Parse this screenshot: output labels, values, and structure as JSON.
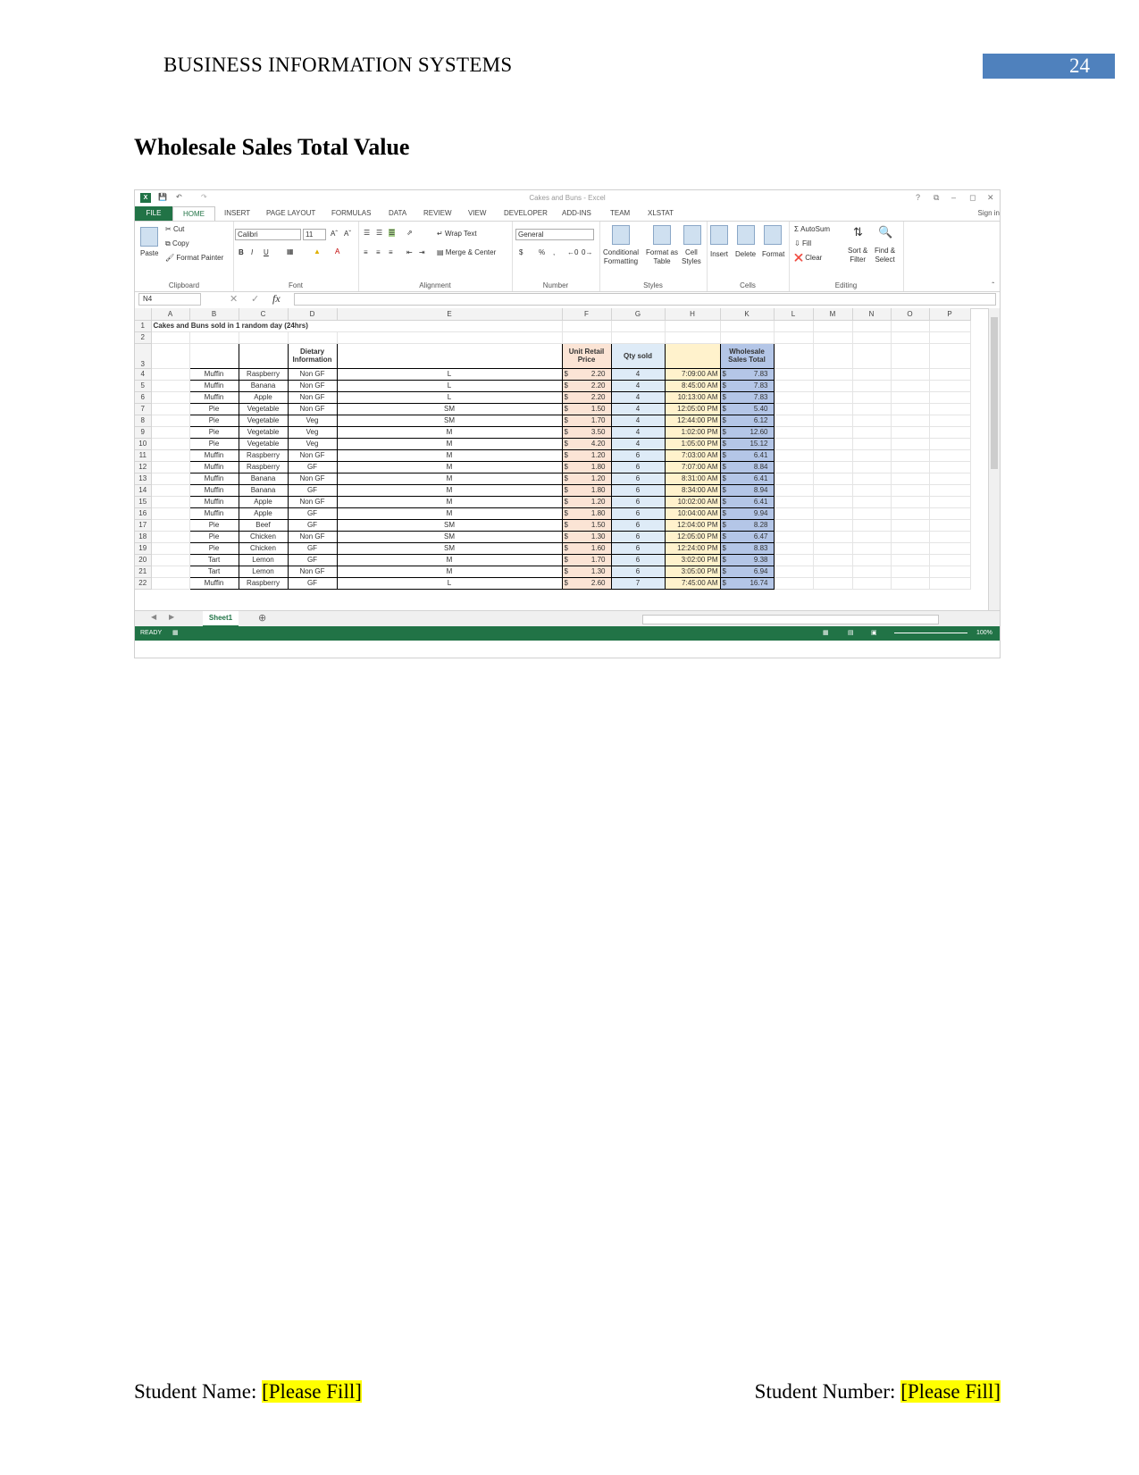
{
  "header": {
    "title": "BUSINESS INFORMATION SYSTEMS",
    "page_number": "24"
  },
  "section_heading": "Wholesale Sales Total Value",
  "excel": {
    "window_title": "Cakes and Buns - Excel",
    "window_controls": [
      "?",
      "⧉",
      "–",
      "◻",
      "✕"
    ],
    "tabs": [
      "FILE",
      "HOME",
      "INSERT",
      "PAGE LAYOUT",
      "FORMULAS",
      "DATA",
      "REVIEW",
      "VIEW",
      "DEVELOPER",
      "ADD-INS",
      "TEAM",
      "XLSTAT"
    ],
    "sign_in": "Sign in",
    "ribbon": {
      "clipboard": {
        "paste": "Paste",
        "cut": "Cut",
        "copy": "Copy",
        "format_painter": "Format Painter",
        "label": "Clipboard"
      },
      "font": {
        "font_name": "Calibri",
        "font_size": "11",
        "bold": "B",
        "italic": "I",
        "underline": "U",
        "label": "Font"
      },
      "alignment": {
        "wrap_text": "Wrap Text",
        "merge_center": "Merge & Center",
        "label": "Alignment"
      },
      "number": {
        "format": "General",
        "currency": "$",
        "percent": "%",
        "comma": ",",
        "label": "Number"
      },
      "styles": {
        "conditional_formatting": [
          "Conditional",
          "Formatting"
        ],
        "format_as_table": [
          "Format as",
          "Table"
        ],
        "cell_styles": [
          "Cell",
          "Styles"
        ],
        "label": "Styles"
      },
      "cells": {
        "insert": "Insert",
        "delete": "Delete",
        "format": "Format",
        "label": "Cells"
      },
      "editing": {
        "autosum": "AutoSum",
        "fill": "Fill",
        "clear": "Clear",
        "sort_filter": [
          "Sort &",
          "Filter"
        ],
        "find_select": [
          "Find &",
          "Select"
        ],
        "label": "Editing"
      }
    },
    "name_box": "N4",
    "fx_symbol": "fx",
    "column_headers": [
      "",
      "A",
      "B",
      "C",
      "D",
      "E",
      "F",
      "G",
      "H",
      "K",
      "L",
      "M",
      "N",
      "O",
      "P"
    ],
    "row1_title": "Cakes and Buns sold in 1 random day (24hrs)",
    "table_header": {
      "dietary": [
        "Dietary",
        "Information"
      ],
      "unit_price": [
        "Unit Retail",
        "Price"
      ],
      "qty": "Qty sold",
      "wholesale": [
        "Wholesale",
        "Sales Total"
      ]
    },
    "currency_symbol": "$",
    "rows": [
      {
        "n": "4",
        "b": "Muffin",
        "c": "Raspberry",
        "d": "Non GF",
        "e": "L",
        "price": "2.20",
        "qty": "4",
        "time": "7:09:00 AM",
        "total": "7.83"
      },
      {
        "n": "5",
        "b": "Muffin",
        "c": "Banana",
        "d": "Non GF",
        "e": "L",
        "price": "2.20",
        "qty": "4",
        "time": "8:45:00 AM",
        "total": "7.83"
      },
      {
        "n": "6",
        "b": "Muffin",
        "c": "Apple",
        "d": "Non GF",
        "e": "L",
        "price": "2.20",
        "qty": "4",
        "time": "10:13:00 AM",
        "total": "7.83"
      },
      {
        "n": "7",
        "b": "Pie",
        "c": "Vegetable",
        "d": "Non GF",
        "e": "SM",
        "price": "1.50",
        "qty": "4",
        "time": "12:05:00 PM",
        "total": "5.40"
      },
      {
        "n": "8",
        "b": "Pie",
        "c": "Vegetable",
        "d": "Veg",
        "e": "SM",
        "price": "1.70",
        "qty": "4",
        "time": "12:44:00 PM",
        "total": "6.12"
      },
      {
        "n": "9",
        "b": "Pie",
        "c": "Vegetable",
        "d": "Veg",
        "e": "M",
        "price": "3.50",
        "qty": "4",
        "time": "1:02:00 PM",
        "total": "12.60"
      },
      {
        "n": "10",
        "b": "Pie",
        "c": "Vegetable",
        "d": "Veg",
        "e": "M",
        "price": "4.20",
        "qty": "4",
        "time": "1:05:00 PM",
        "total": "15.12"
      },
      {
        "n": "11",
        "b": "Muffin",
        "c": "Raspberry",
        "d": "Non GF",
        "e": "M",
        "price": "1.20",
        "qty": "6",
        "time": "7:03:00 AM",
        "total": "6.41"
      },
      {
        "n": "12",
        "b": "Muffin",
        "c": "Raspberry",
        "d": "GF",
        "e": "M",
        "price": "1.80",
        "qty": "6",
        "time": "7:07:00 AM",
        "total": "8.84"
      },
      {
        "n": "13",
        "b": "Muffin",
        "c": "Banana",
        "d": "Non GF",
        "e": "M",
        "price": "1.20",
        "qty": "6",
        "time": "8:31:00 AM",
        "total": "6.41"
      },
      {
        "n": "14",
        "b": "Muffin",
        "c": "Banana",
        "d": "GF",
        "e": "M",
        "price": "1.80",
        "qty": "6",
        "time": "8:34:00 AM",
        "total": "8.94"
      },
      {
        "n": "15",
        "b": "Muffin",
        "c": "Apple",
        "d": "Non GF",
        "e": "M",
        "price": "1.20",
        "qty": "6",
        "time": "10:02:00 AM",
        "total": "6.41"
      },
      {
        "n": "16",
        "b": "Muffin",
        "c": "Apple",
        "d": "GF",
        "e": "M",
        "price": "1.80",
        "qty": "6",
        "time": "10:04:00 AM",
        "total": "9.94"
      },
      {
        "n": "17",
        "b": "Pie",
        "c": "Beef",
        "d": "GF",
        "e": "SM",
        "price": "1.50",
        "qty": "6",
        "time": "12:04:00 PM",
        "total": "8.28"
      },
      {
        "n": "18",
        "b": "Pie",
        "c": "Chicken",
        "d": "Non GF",
        "e": "SM",
        "price": "1.30",
        "qty": "6",
        "time": "12:05:00 PM",
        "total": "6.47"
      },
      {
        "n": "19",
        "b": "Pie",
        "c": "Chicken",
        "d": "GF",
        "e": "SM",
        "price": "1.60",
        "qty": "6",
        "time": "12:24:00 PM",
        "total": "8.83"
      },
      {
        "n": "20",
        "b": "Tart",
        "c": "Lemon",
        "d": "GF",
        "e": "M",
        "price": "1.70",
        "qty": "6",
        "time": "3:02:00 PM",
        "total": "9.38"
      },
      {
        "n": "21",
        "b": "Tart",
        "c": "Lemon",
        "d": "Non GF",
        "e": "M",
        "price": "1.30",
        "qty": "6",
        "time": "3:05:00 PM",
        "total": "6.94"
      },
      {
        "n": "22",
        "b": "Muffin",
        "c": "Raspberry",
        "d": "GF",
        "e": "L",
        "price": "2.60",
        "qty": "7",
        "time": "7:45:00 AM",
        "total": "16.74"
      }
    ],
    "sheet_tab": "Sheet1",
    "status": "READY",
    "zoom": "100%"
  },
  "footer": {
    "student_name_label": "Student Name:",
    "student_name_value": "[Please Fill]",
    "student_number_label": "Student Number:",
    "student_number_value": "[Please Fill]"
  },
  "colors": {
    "excel_green": "#217346",
    "page_number_bg": "#4f81bd",
    "highlight": "#ffff00",
    "price_fill": "#fbe4d5",
    "qty_fill": "#deebf7",
    "time_fill": "#fff2cc",
    "total_fill": "#b4c6e7"
  }
}
